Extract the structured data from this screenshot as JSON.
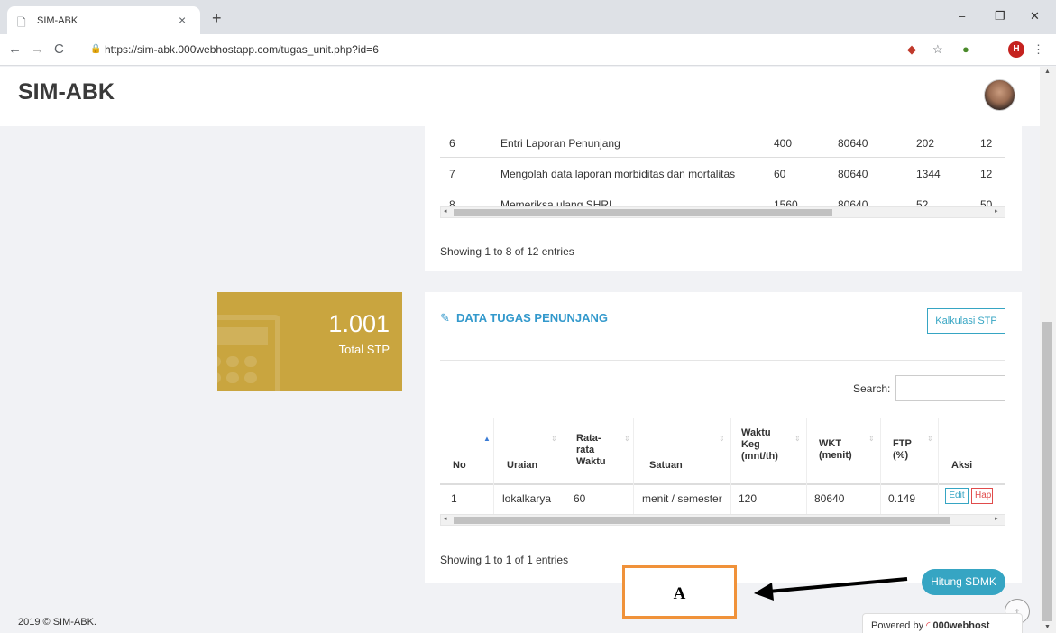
{
  "browser": {
    "tab_title": "SIM-ABK",
    "tab_close": "×",
    "new_tab": "+",
    "url": "https://sim-abk.000webhostapp.com/tugas_unit.php?id=6",
    "profile_initial": "H",
    "window_controls": [
      "–",
      "❐",
      "✕"
    ]
  },
  "header": {
    "brand": "SIM-ABK"
  },
  "top_table": {
    "rows": [
      {
        "no": "6",
        "uraian": "Entri Laporan Penunjang",
        "c3": "400",
        "c4": "80640",
        "c5": "202",
        "c6": "12"
      },
      {
        "no": "7",
        "uraian": "Mengolah data laporan morbiditas dan mortalitas",
        "c3": "60",
        "c4": "80640",
        "c5": "1344",
        "c6": "12"
      },
      {
        "no": "8",
        "uraian": "Memeriksa ulang SHRI",
        "c3": "1560",
        "c4": "80640",
        "c5": "52",
        "c6": "50"
      }
    ],
    "info": "Showing 1 to 8 of 12 entries"
  },
  "stat": {
    "value": "1.001",
    "label": "Total STP"
  },
  "section": {
    "title": "DATA TUGAS PENUNJANG",
    "kalkulasi_button": "Kalkulasi STP",
    "search_label": "Search:",
    "search_value": "",
    "columns": [
      {
        "l1": "No",
        "l2": "",
        "l3": ""
      },
      {
        "l1": "Uraian",
        "l2": "",
        "l3": ""
      },
      {
        "l1": "Rata-",
        "l2": "rata",
        "l3": "Waktu"
      },
      {
        "l1": "Satuan",
        "l2": "",
        "l3": ""
      },
      {
        "l1": "Waktu",
        "l2": "Keg",
        "l3": "(mnt/th)"
      },
      {
        "l1": "WKT",
        "l2": "(menit)",
        "l3": ""
      },
      {
        "l1": "FTP",
        "l2": "(%)",
        "l3": ""
      },
      {
        "l1": "Aksi",
        "l2": "",
        "l3": ""
      }
    ],
    "row": {
      "no": "1",
      "uraian": "lokalkarya",
      "rata": "60",
      "satuan": "menit / semester",
      "waktu_keg": "120",
      "wkt": "80640",
      "ftp": "0.149",
      "edit": "Edit",
      "hapus": "Hapus"
    },
    "info": "Showing 1 to 1 of 1 entries",
    "hitung_button": "Hitung SDMK"
  },
  "annotation": {
    "label": "A"
  },
  "footer": {
    "copyright": "2019 © SIM-ABK.",
    "powered_prefix": "Powered by",
    "powered_brand": "000webhost"
  }
}
